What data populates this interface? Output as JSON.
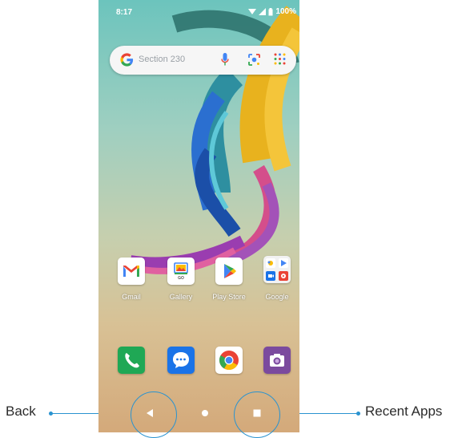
{
  "status_bar": {
    "time": "8:17",
    "battery": "100%"
  },
  "search": {
    "text": "Section 230"
  },
  "apps": [
    {
      "label": "Gmail"
    },
    {
      "label": "Gallery",
      "badge": "GO"
    },
    {
      "label": "Play Store"
    },
    {
      "label": "Google"
    }
  ],
  "dock": [
    "phone-icon",
    "messages-icon",
    "chrome-icon",
    "camera-icon"
  ],
  "callouts": {
    "back": "Back",
    "recent": "Recent Apps"
  },
  "colors": {
    "callout": "#2a93d0",
    "phone_green": "#1fa855",
    "messages_blue": "#1a73e8",
    "camera_purple": "#7b4a9e"
  }
}
